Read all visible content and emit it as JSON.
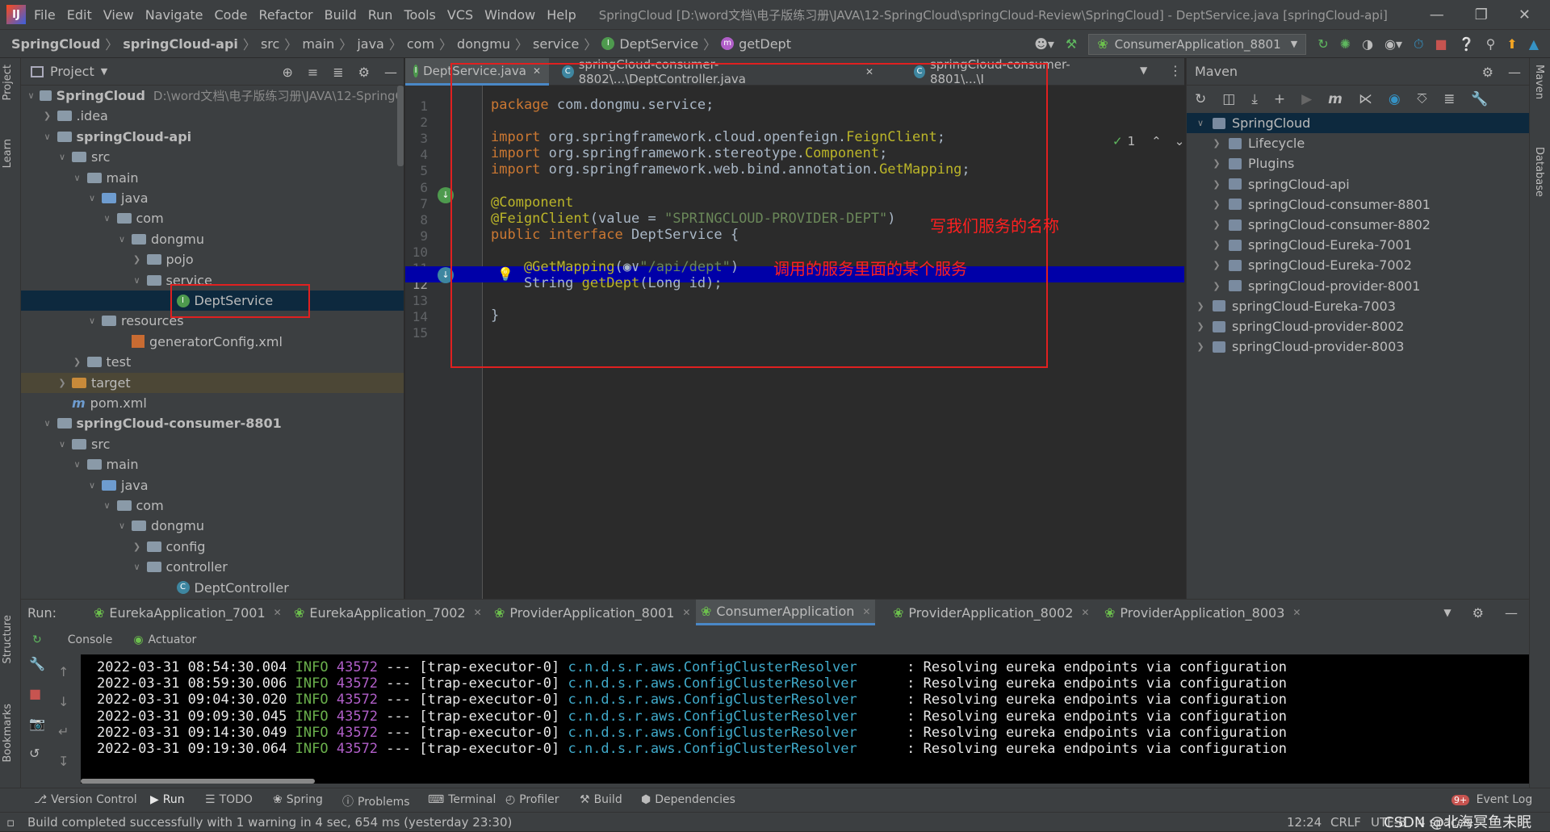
{
  "menubar": {
    "items": [
      "File",
      "Edit",
      "View",
      "Navigate",
      "Code",
      "Refactor",
      "Build",
      "Run",
      "Tools",
      "VCS",
      "Window",
      "Help"
    ],
    "title": "SpringCloud [D:\\word文档\\电子版练习册\\JAVA\\12-SpringCloud\\springCloud-Review\\SpringCloud] - DeptService.java [springCloud-api]"
  },
  "breadcrumb": [
    "SpringCloud",
    "springCloud-api",
    "src",
    "main",
    "java",
    "com",
    "dongmu",
    "service",
    "DeptService",
    "getDept"
  ],
  "runconfig": "ConsumerApplication_8801",
  "project": {
    "header": "Project",
    "tree": [
      {
        "label": "SpringCloud",
        "extra": "D:\\word文档\\电子版练习册\\JAVA\\12-SpringC",
        "indent": 0,
        "arrow": "down",
        "icon": "folder",
        "bold": true
      },
      {
        "label": ".idea",
        "indent": 1,
        "arrow": "right",
        "icon": "folder"
      },
      {
        "label": "springCloud-api",
        "indent": 1,
        "arrow": "down",
        "icon": "folder",
        "bold": true
      },
      {
        "label": "src",
        "indent": 2,
        "arrow": "down",
        "icon": "folder"
      },
      {
        "label": "main",
        "indent": 3,
        "arrow": "down",
        "icon": "folder"
      },
      {
        "label": "java",
        "indent": 4,
        "arrow": "down",
        "icon": "src"
      },
      {
        "label": "com",
        "indent": 5,
        "arrow": "down",
        "icon": "folder"
      },
      {
        "label": "dongmu",
        "indent": 6,
        "arrow": "down",
        "icon": "folder"
      },
      {
        "label": "pojo",
        "indent": 7,
        "arrow": "right",
        "icon": "folder"
      },
      {
        "label": "service",
        "indent": 7,
        "arrow": "down",
        "icon": "folder"
      },
      {
        "label": "DeptService",
        "indent": 9,
        "arrow": "",
        "icon": "interface",
        "selected": true
      },
      {
        "label": "resources",
        "indent": 4,
        "arrow": "down",
        "icon": "folder"
      },
      {
        "label": "generatorConfig.xml",
        "indent": 6,
        "arrow": "",
        "icon": "xml"
      },
      {
        "label": "test",
        "indent": 3,
        "arrow": "right",
        "icon": "folder"
      },
      {
        "label": "target",
        "indent": 2,
        "arrow": "right",
        "icon": "orange",
        "highlight": true
      },
      {
        "label": "pom.xml",
        "indent": 2,
        "arrow": "",
        "icon": "maven"
      },
      {
        "label": "springCloud-consumer-8801",
        "indent": 1,
        "arrow": "down",
        "icon": "folder",
        "bold": true
      },
      {
        "label": "src",
        "indent": 2,
        "arrow": "down",
        "icon": "folder"
      },
      {
        "label": "main",
        "indent": 3,
        "arrow": "down",
        "icon": "folder"
      },
      {
        "label": "java",
        "indent": 4,
        "arrow": "down",
        "icon": "src"
      },
      {
        "label": "com",
        "indent": 5,
        "arrow": "down",
        "icon": "folder"
      },
      {
        "label": "dongmu",
        "indent": 6,
        "arrow": "down",
        "icon": "folder"
      },
      {
        "label": "config",
        "indent": 7,
        "arrow": "right",
        "icon": "folder"
      },
      {
        "label": "controller",
        "indent": 7,
        "arrow": "down",
        "icon": "folder"
      },
      {
        "label": "DeptController",
        "indent": 9,
        "arrow": "",
        "icon": "class"
      }
    ]
  },
  "editor": {
    "tabs": [
      "DeptService.java",
      "springCloud-consumer-8802\\...\\DeptController.java",
      "springCloud-consumer-8801\\...\\I"
    ],
    "inspection": "1",
    "line_numbers": [
      "1",
      "2",
      "3",
      "4",
      "5",
      "6",
      "7",
      "8",
      "9",
      "10",
      "11",
      "12",
      "13",
      "14",
      "15"
    ],
    "lines": [
      [
        [
          "kw",
          "package "
        ],
        [
          "ty",
          "com.dongmu.service;"
        ]
      ],
      [],
      [
        [
          "kw",
          "import "
        ],
        [
          "ty",
          "org.springframework.cloud.openfeign."
        ],
        [
          "an",
          "FeignClient"
        ],
        [
          "ty",
          ";"
        ]
      ],
      [
        [
          "kw",
          "import "
        ],
        [
          "ty",
          "org.springframework.stereotype."
        ],
        [
          "an",
          "Component"
        ],
        [
          "ty",
          ";"
        ]
      ],
      [
        [
          "kw",
          "import "
        ],
        [
          "ty",
          "org.springframework.web.bind.annotation."
        ],
        [
          "an",
          "GetMapping"
        ],
        [
          "ty",
          ";"
        ]
      ],
      [],
      [
        [
          "an",
          "@Component"
        ]
      ],
      [
        [
          "an",
          "@FeignClient"
        ],
        [
          "ty",
          "(value = "
        ],
        [
          "st",
          "\"SPRINGCLOUD-PROVIDER-DEPT\""
        ],
        [
          "ty",
          ")"
        ]
      ],
      [
        [
          "kw",
          "public interface "
        ],
        [
          "ty",
          "DeptService {"
        ]
      ],
      [],
      [
        [
          "an",
          "    @GetMapping"
        ],
        [
          "ty",
          "("
        ],
        [
          "ty",
          "◉∨"
        ],
        [
          "st",
          "\"/api/dept\""
        ],
        [
          "ty",
          ")"
        ]
      ],
      [
        [
          "ty",
          "    String "
        ],
        [
          "an",
          "getDept"
        ],
        [
          "ty",
          "(Long id);"
        ]
      ],
      [],
      [
        [
          "ty",
          "}"
        ]
      ],
      []
    ],
    "annotations": [
      "写我们服务的名称",
      "调用的服务里面的某个服务"
    ]
  },
  "maven": {
    "header": "Maven",
    "items": [
      {
        "label": "SpringCloud",
        "indent": 0,
        "arrow": "down",
        "selected": true
      },
      {
        "label": "Lifecycle",
        "indent": 1,
        "arrow": "right"
      },
      {
        "label": "Plugins",
        "indent": 1,
        "arrow": "right"
      },
      {
        "label": "springCloud-api",
        "indent": 1,
        "arrow": "right"
      },
      {
        "label": "springCloud-consumer-8801",
        "indent": 1,
        "arrow": "right"
      },
      {
        "label": "springCloud-consumer-8802",
        "indent": 1,
        "arrow": "right"
      },
      {
        "label": "springCloud-Eureka-7001",
        "indent": 1,
        "arrow": "right"
      },
      {
        "label": "springCloud-Eureka-7002",
        "indent": 1,
        "arrow": "right"
      },
      {
        "label": "springCloud-provider-8001",
        "indent": 1,
        "arrow": "right"
      },
      {
        "label": "springCloud-Eureka-7003",
        "indent": 0,
        "arrow": "right"
      },
      {
        "label": "springCloud-provider-8002",
        "indent": 0,
        "arrow": "right"
      },
      {
        "label": "springCloud-provider-8003",
        "indent": 0,
        "arrow": "right"
      }
    ]
  },
  "run": {
    "label": "Run:",
    "tabs": [
      "EurekaApplication_7001",
      "EurekaApplication_7002",
      "ProviderApplication_8001",
      "ConsumerApplication",
      "ProviderApplication_8002",
      "ProviderApplication_8003"
    ],
    "console_tab": "Console",
    "actuator_tab": "Actuator",
    "logs": [
      {
        "date": "2022-03-31 08:54:30.004",
        "level": "INFO",
        "pid": "43572",
        "thread": "--- [trap-executor-0]",
        "logger": "c.n.d.s.r.aws.ConfigClusterResolver",
        "msg": "     : Resolving eureka endpoints via configuration"
      },
      {
        "date": "2022-03-31 08:59:30.006",
        "level": "INFO",
        "pid": "43572",
        "thread": "--- [trap-executor-0]",
        "logger": "c.n.d.s.r.aws.ConfigClusterResolver",
        "msg": "     : Resolving eureka endpoints via configuration"
      },
      {
        "date": "2022-03-31 09:04:30.020",
        "level": "INFO",
        "pid": "43572",
        "thread": "--- [trap-executor-0]",
        "logger": "c.n.d.s.r.aws.ConfigClusterResolver",
        "msg": "     : Resolving eureka endpoints via configuration"
      },
      {
        "date": "2022-03-31 09:09:30.045",
        "level": "INFO",
        "pid": "43572",
        "thread": "--- [trap-executor-0]",
        "logger": "c.n.d.s.r.aws.ConfigClusterResolver",
        "msg": "     : Resolving eureka endpoints via configuration"
      },
      {
        "date": "2022-03-31 09:14:30.049",
        "level": "INFO",
        "pid": "43572",
        "thread": "--- [trap-executor-0]",
        "logger": "c.n.d.s.r.aws.ConfigClusterResolver",
        "msg": "     : Resolving eureka endpoints via configuration"
      },
      {
        "date": "2022-03-31 09:19:30.064",
        "level": "INFO",
        "pid": "43572",
        "thread": "--- [trap-executor-0]",
        "logger": "c.n.d.s.r.aws.ConfigClusterResolver",
        "msg": "     : Resolving eureka endpoints via configuration"
      }
    ]
  },
  "toolwindows": {
    "bottom": [
      "Version Control",
      "Run",
      "TODO",
      "Spring",
      "Problems",
      "Terminal",
      "Profiler",
      "Build",
      "Dependencies"
    ],
    "event_log": "Event Log",
    "event_badge": "9+",
    "left": [
      "Project",
      "Learn",
      "Structure",
      "Bookmarks"
    ],
    "right": [
      "Maven",
      "Database"
    ]
  },
  "status": {
    "message": "Build completed successfully with 1 warning in 4 sec, 654 ms (yesterday 23:30)",
    "position": "12:24",
    "line_sep": "CRLF",
    "encoding": "UTF-8",
    "indent": "4 spaces",
    "watermark": "CSDN @北海冥鱼未眠"
  }
}
